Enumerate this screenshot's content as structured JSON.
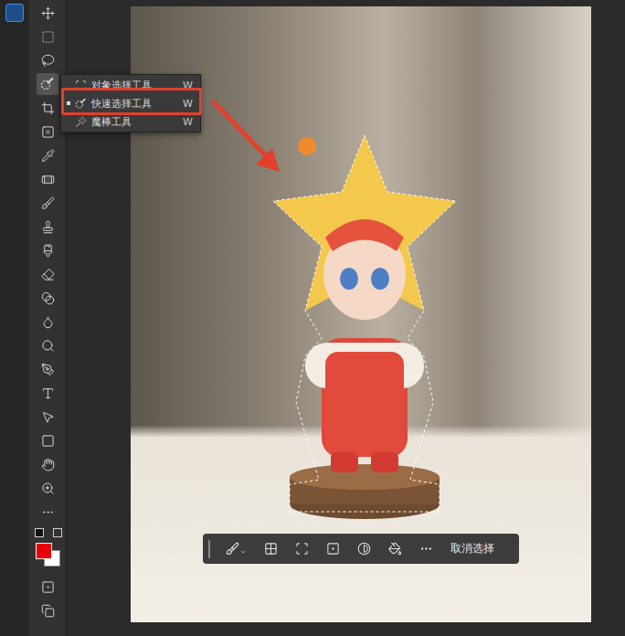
{
  "toolbar": {
    "tools": [
      {
        "selected": false
      },
      {
        "selected": false
      },
      {
        "selected": false
      },
      {
        "selected": true
      },
      {
        "selected": false
      },
      {
        "selected": false
      },
      {
        "selected": false
      },
      {
        "selected": false
      },
      {
        "selected": false
      },
      {
        "selected": false
      },
      {
        "selected": false
      },
      {
        "selected": false
      },
      {
        "selected": false
      },
      {
        "selected": false
      },
      {
        "selected": false
      },
      {
        "selected": false
      },
      {
        "selected": false
      },
      {
        "selected": false
      },
      {
        "selected": false
      },
      {
        "selected": false
      },
      {
        "selected": false
      },
      {
        "selected": false
      }
    ],
    "foreground": {
      "color": "#e8000b"
    },
    "background": {
      "color": "#ffffff"
    }
  },
  "flyout": {
    "items": [
      {
        "label": "对象选择工具",
        "shortcut": "W",
        "selected": false
      },
      {
        "label": "快速选择工具",
        "shortcut": "W",
        "selected": true
      },
      {
        "label": "魔棒工具",
        "shortcut": "W",
        "selected": false
      }
    ]
  },
  "taskbar": {
    "deselect": "取消选择"
  }
}
